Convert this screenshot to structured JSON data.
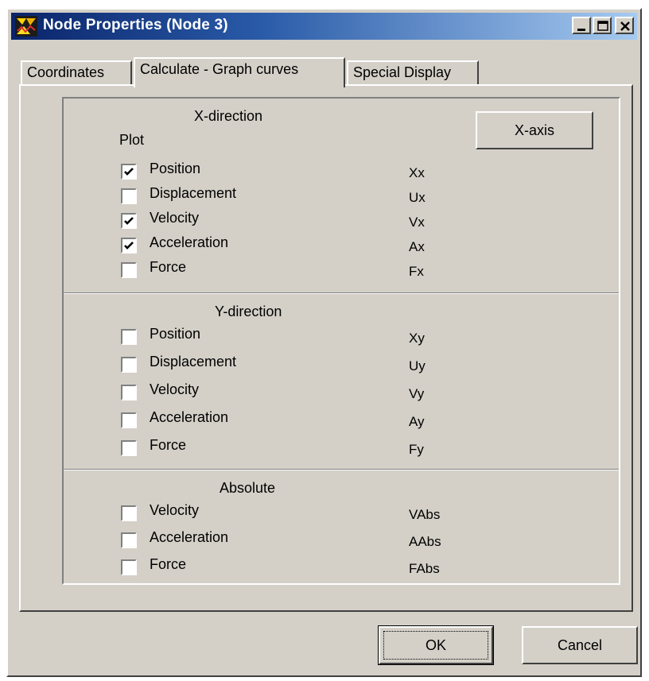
{
  "window": {
    "title": "Node Properties (Node 3)"
  },
  "tabs": [
    {
      "label": "Coordinates",
      "active": false
    },
    {
      "label": "Calculate - Graph curves",
      "active": true
    },
    {
      "label": "Special Display",
      "active": false
    }
  ],
  "x_direction": {
    "title": "X-direction",
    "plot_label": "Plot",
    "items": [
      {
        "label": "Position",
        "symbol": "Xx",
        "checked": true
      },
      {
        "label": "Displacement",
        "symbol": "Ux",
        "checked": false
      },
      {
        "label": "Velocity",
        "symbol": "Vx",
        "checked": true
      },
      {
        "label": "Acceleration",
        "symbol": "Ax",
        "checked": true
      },
      {
        "label": "Force",
        "symbol": "Fx",
        "checked": false
      }
    ]
  },
  "x_axis_button": "X-axis",
  "y_direction": {
    "title": "Y-direction",
    "items": [
      {
        "label": "Position",
        "symbol": "Xy",
        "checked": false
      },
      {
        "label": "Displacement",
        "symbol": "Uy",
        "checked": false
      },
      {
        "label": "Velocity",
        "symbol": "Vy",
        "checked": false
      },
      {
        "label": "Acceleration",
        "symbol": "Ay",
        "checked": false
      },
      {
        "label": "Force",
        "symbol": "Fy",
        "checked": false
      }
    ]
  },
  "absolute": {
    "title": "Absolute",
    "items": [
      {
        "label": "Velocity",
        "symbol": "VAbs",
        "checked": false
      },
      {
        "label": "Acceleration",
        "symbol": "AAbs",
        "checked": false
      },
      {
        "label": "Force",
        "symbol": "FAbs",
        "checked": false
      }
    ]
  },
  "buttons": {
    "ok": "OK",
    "cancel": "Cancel"
  },
  "colors": {
    "face": "#d4d0c8",
    "title_start": "#0a246a",
    "title_end": "#a6caf0"
  }
}
